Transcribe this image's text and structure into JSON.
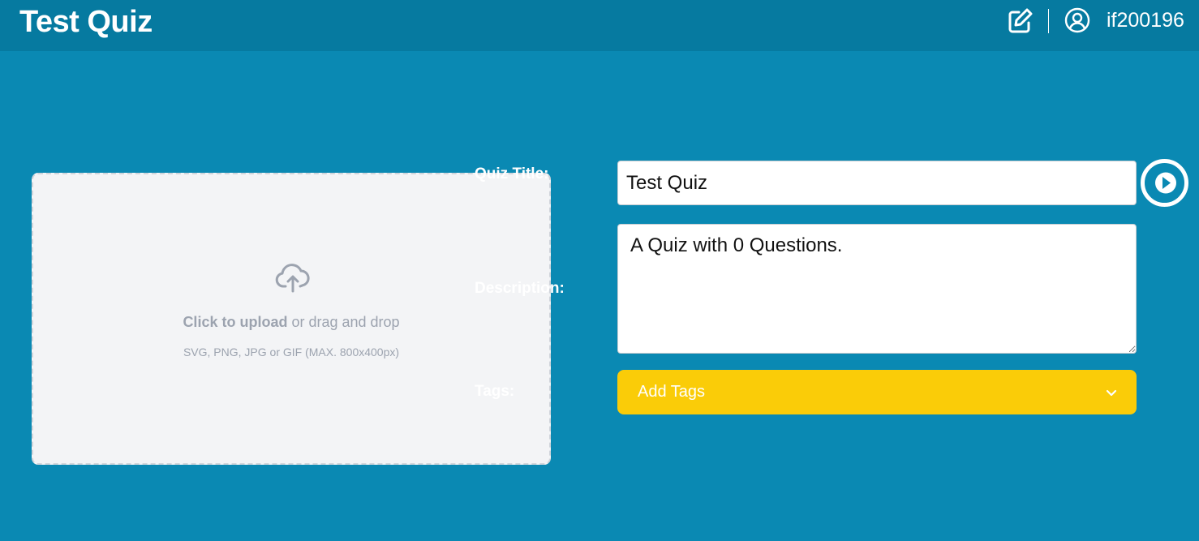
{
  "header": {
    "title": "Test Quiz",
    "edit_icon": "edit-square-icon",
    "user_icon": "user-circle-icon",
    "username": "if200196"
  },
  "upload": {
    "icon": "cloud-upload-icon",
    "cta_bold": "Click to upload",
    "cta_rest": " or drag and drop",
    "hint": "SVG, PNG, JPG or GIF (MAX. 800x400px)"
  },
  "form": {
    "title_label": "Quiz Title:",
    "title_value": "Test Quiz",
    "description_label": "Description:",
    "description_value": "A Quiz with 0 Questions.",
    "tags_label": "Tags:",
    "tags_placeholder": "Add Tags",
    "play_icon": "play-circle-icon",
    "chevron_icon": "chevron-down-icon"
  },
  "colors": {
    "background": "#0a89b3",
    "header": "#067aa0",
    "tags_button": "#facc08",
    "upload_bg": "#f3f4f6"
  }
}
